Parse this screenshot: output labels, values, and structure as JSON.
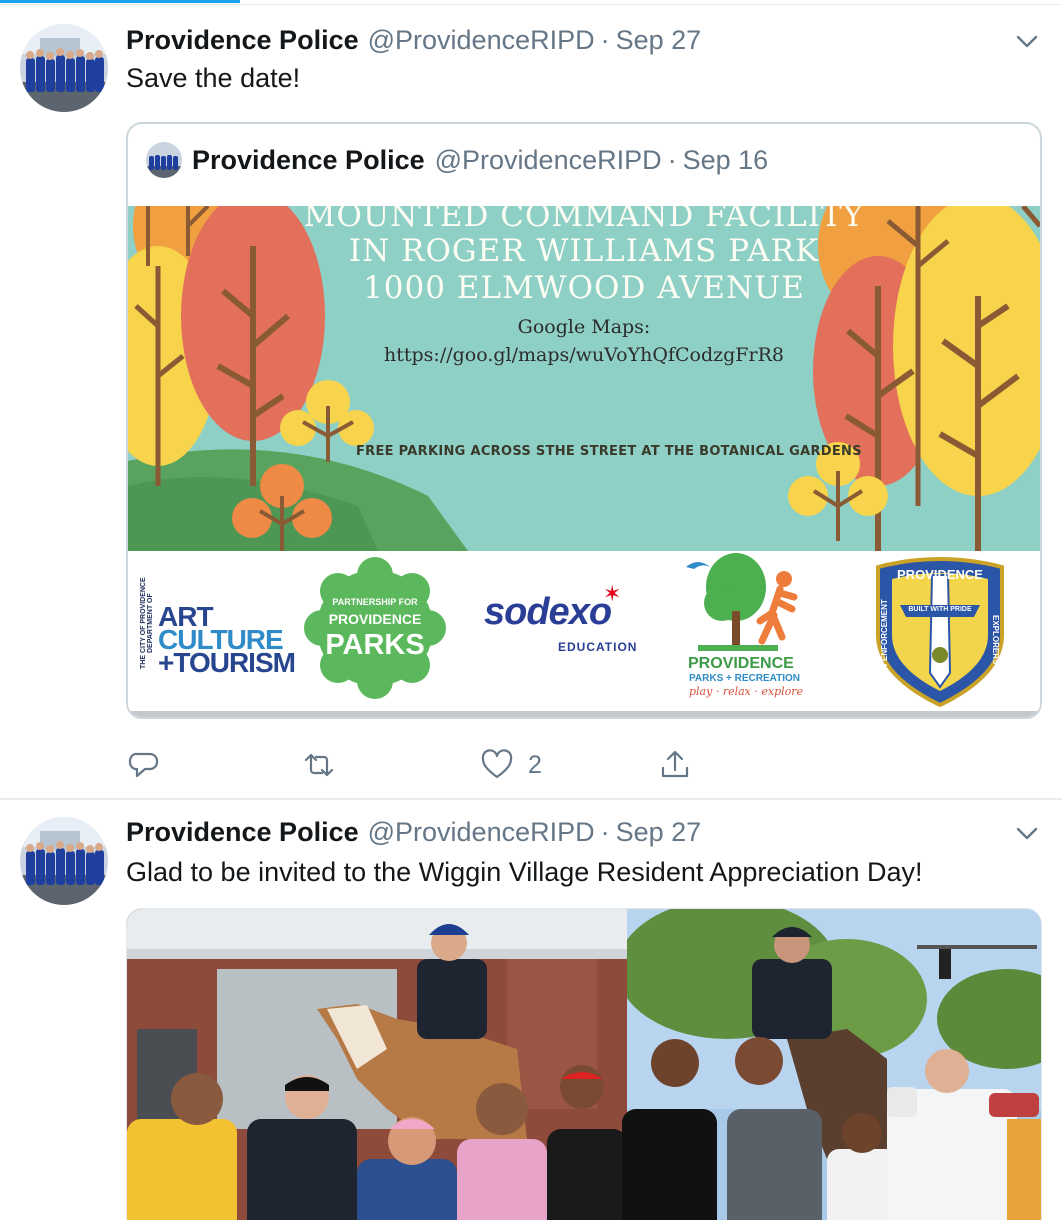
{
  "tweets": [
    {
      "author_name": "Providence Police",
      "handle": "@ProvidenceRIPD",
      "separator": "·",
      "date": "Sep 27",
      "text": "Save the date!",
      "quoted": {
        "author_name": "Providence Police",
        "handle": "@ProvidenceRIPD",
        "separator": "·",
        "date": "Sep 16",
        "flyer": {
          "line1": "MOUNTED COMMAND FACILITY",
          "line2": "IN ROGER WILLIAMS PARK",
          "line3": "1000 ELMWOOD AVENUE",
          "maps_label": "Google Maps:",
          "maps_url": "https://goo.gl/maps/wuVoYhQfCodzgFrR8",
          "parking": "FREE PARKING ACROSS STHE STREET AT THE BOTANICAL GARDENS"
        },
        "logos": {
          "art_side": "THE CITY OF PROVIDENCE DEPARTMENT OF",
          "art_1": "ART",
          "art_2": "CULTURE",
          "art_3": "+TOURISM",
          "ppp_1": "PARTNERSHIP FOR",
          "ppp_2": "PROVIDENCE",
          "ppp_3": "PARKS",
          "sodexo": "sodexo",
          "sodexo_sub": "EDUCATION",
          "parks_1": "PROVIDENCE",
          "parks_2": "PARKS + RECREATION",
          "parks_3": "play · relax · explore",
          "shield_top": "PROVIDENCE",
          "shield_left": "LAW ENFORCEMENT",
          "shield_right": "EXPLORERS",
          "shield_banner": "BUILT WITH PRIDE"
        }
      },
      "actions": {
        "like_count": "2"
      }
    },
    {
      "author_name": "Providence Police",
      "handle": "@ProvidenceRIPD",
      "separator": "·",
      "date": "Sep 27",
      "text": "Glad to be invited to the Wiggin Village Resident Appreciation Day!"
    }
  ],
  "icons": {
    "reply": "reply-icon",
    "retweet": "retweet-icon",
    "like": "heart-icon",
    "share": "share-icon",
    "caret": "chevron-down-icon"
  },
  "colors": {
    "accent": "#1da1f2",
    "secondary_text": "#657786",
    "border": "#ccd6dd"
  }
}
